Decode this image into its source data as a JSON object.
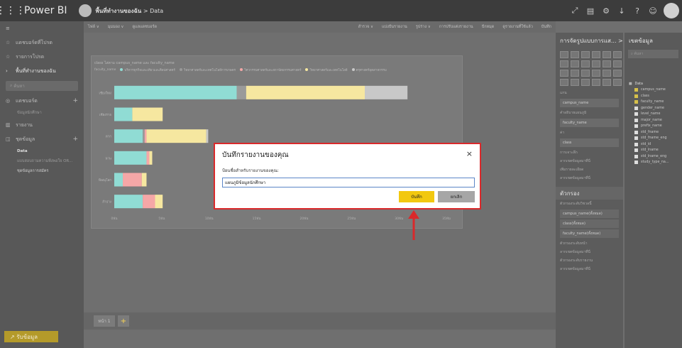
{
  "topbar": {
    "app_title": "Power BI",
    "workspace": "พื้นที่ทำงานของฉัน",
    "breadcrumb_sep": ">",
    "breadcrumb_page": "Data"
  },
  "leftnav": {
    "items": [
      {
        "label": "แดชบอร์ดที่โปรด",
        "icon": "star-icon"
      },
      {
        "label": "รายการโปรด",
        "icon": "star-icon"
      },
      {
        "label": "พื้นที่ทำงานของฉัน",
        "icon": "workspace-icon"
      }
    ],
    "search_placeholder": "ค้นหา",
    "sections": [
      {
        "label": "แดชบอร์ด",
        "subs": [
          "ข้อมูลนักศึกษา"
        ]
      },
      {
        "label": "รายงาน",
        "subs": []
      },
      {
        "label": "ชุดข้อมูล",
        "subs": [
          "Data",
          "แบบสอบถามความพึงพอใจ OR...",
          "ชุดข้อมูลการสมัคร"
        ]
      }
    ],
    "get_data": "↗ รับข้อมูล"
  },
  "toolbar": {
    "left": [
      "ไฟล์ ∨",
      "มุมมอง ∨",
      "ดูแลแดชบอร์ด"
    ],
    "right": [
      "สำรวจ ∨",
      "แบ่งปันรายงาน",
      "รูปร่าง ∨",
      "การปรับแต่งรายงาน",
      "ปักหมุด",
      "ดูรายงานที่ใช้แล้ว",
      "บันทึก"
    ]
  },
  "chart": {
    "title": "class ไล่ตาม campus_name และ faculty_name",
    "legend_label": "faculty_name",
    "legend": [
      {
        "name": "บริหารธุรกิจและเทียวและศิลปศาสตร์",
        "color": "#90dcd4"
      },
      {
        "name": "วิทยาศาสตร์และเทคโนโลยีการเกษตร",
        "color": "#9a9a9a"
      },
      {
        "name": "วิศวกรรมศาสตร์และสถาปัตยกรรมศาสตร์",
        "color": "#f5a7a7"
      },
      {
        "name": "วิทยาศาสตร์และเทคโนโลยี",
        "color": "#f6e7a0"
      },
      {
        "name": "ครุศาสตร์อุตสาหกรรม",
        "color": "#c8c8c8"
      }
    ]
  },
  "chart_data": {
    "type": "bar",
    "orientation": "horizontal",
    "stacked": true,
    "title": "class ไล่ตาม campus_name และ faculty_name",
    "legend_title": "faculty_name",
    "categories": [
      "เชียงใหม่",
      "เชียงราย",
      "ตาก",
      "น่าน",
      "พิษณุโลก",
      "ลำปาง"
    ],
    "x_ticks": [
      "0พัน",
      "5พัน",
      "10พัน",
      "15พัน",
      "20พัน",
      "25พัน",
      "30พัน",
      "35พัน"
    ],
    "xlim": [
      0,
      35
    ],
    "series": [
      {
        "name": "บริหารธุรกิจและเทียวและศิลปศาสตร์",
        "values": [
          12.9,
          1.9,
          3.0,
          3.4,
          0.9,
          3.0
        ]
      },
      {
        "name": "วิทยาศาสตร์และเทคโนโลยีการเกษตร",
        "values": [
          1.0,
          0,
          0.2,
          0,
          0,
          0
        ]
      },
      {
        "name": "วิศวกรรมศาสตร์และสถาปัตยกรรมศาสตร์",
        "values": [
          0,
          0,
          0.2,
          0.3,
          2.0,
          1.3
        ]
      },
      {
        "name": "วิทยาศาสตร์และเทคโนโลยี",
        "values": [
          12.5,
          3.2,
          6.3,
          0.3,
          0.5,
          0.8
        ]
      },
      {
        "name": "ครุศาสตร์อุตสาหกรรม",
        "values": [
          4.5,
          0,
          0.2,
          0,
          0,
          0
        ]
      }
    ]
  },
  "tabs": {
    "page1": "หน้า 1",
    "add": "+"
  },
  "viz_pane": {
    "header": "การจัดรูปแบบการแส... >",
    "wells": [
      {
        "label": "แกน",
        "value": "campus_name"
      },
      {
        "label": "คำอธิบายแผนภูมิ",
        "value": "faculty_name"
      },
      {
        "label": "ค่า",
        "value": "class"
      }
    ],
    "extras": [
      "การเจาะลึก",
      "ลากเขตข้อมูลมาที่นี่",
      "เพิ่มรายละเอียด",
      "ลากเขตข้อมูลมาที่นี่"
    ],
    "filters_header": "ตัวกรอง",
    "filter_level1": "ตัวกรองระดับวิชวลนี้",
    "filters": [
      "campus_name(ทั้งหมด)",
      "class(ทั้งหมด)",
      "faculty_name(ทั้งหมด)"
    ],
    "filter_level2": "ตัวกรองระดับหน้า",
    "drop_here": "ลากเขตข้อมูลมาที่นี่",
    "filter_level3": "ตัวกรองระดับรายงาน",
    "drop_here2": "ลากเขตข้อมูลมาที่นี่"
  },
  "fields_pane": {
    "header": "เขตข้อมูล",
    "search_placeholder": "ค้นหา",
    "table": "Data",
    "fields": [
      {
        "name": "campus_name",
        "checked": true
      },
      {
        "name": "class",
        "checked": true
      },
      {
        "name": "faculty_name",
        "checked": true
      },
      {
        "name": "gender_name",
        "checked": false
      },
      {
        "name": "level_name",
        "checked": false
      },
      {
        "name": "major_name",
        "checked": false
      },
      {
        "name": "prefix_name",
        "checked": false
      },
      {
        "name": "std_fname",
        "checked": false
      },
      {
        "name": "std_fname_eng",
        "checked": false
      },
      {
        "name": "std_id",
        "checked": false
      },
      {
        "name": "std_lname",
        "checked": false
      },
      {
        "name": "std_lname_eng",
        "checked": false
      },
      {
        "name": "study_type_na...",
        "checked": false
      }
    ]
  },
  "dialog": {
    "title": "บันทึกรายงานของคุณ",
    "close": "×",
    "label": "ป้อนชื่อสำหรับรายงานของคุณ:",
    "input_value": "แผนภูมิข้อมูลนักศึกษา",
    "save": "บันทึก",
    "cancel": "ยกเลิก"
  },
  "colors": {
    "accent": "#f2c80f",
    "highlight": "#d9292b"
  }
}
